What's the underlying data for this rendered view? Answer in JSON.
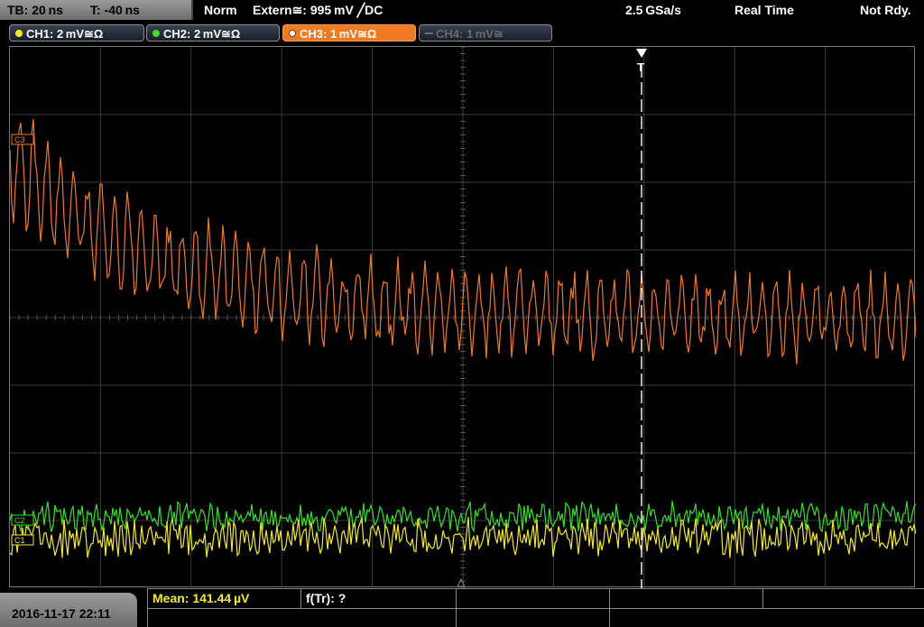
{
  "topbar": {
    "timebase": "TB: 20 ns",
    "trigger_time": "T: -40 ns",
    "mode": "Norm",
    "trigger_source": "Extern≅: 995 mV ╱DC",
    "sample_rate": "2.5 GSa/s",
    "acq_mode": "Real Time",
    "status": "Not Rdy."
  },
  "channels": [
    {
      "label": "CH1: 2 mV≅Ω",
      "color": "#f2ea23",
      "state": "on"
    },
    {
      "label": "CH2: 2 mV≅Ω",
      "color": "#36e02a",
      "state": "on"
    },
    {
      "label": "CH3: 1 mV≅Ω",
      "color": "#f07a22",
      "state": "active"
    },
    {
      "label": "CH4: 1 mV≅",
      "color": "#6a6a6a",
      "state": "off"
    }
  ],
  "markers": {
    "trigger": "T",
    "ch3": "C3",
    "ch2": "C2",
    "ch1": "C1"
  },
  "footer": {
    "datetime": "2016-11-17 22:11",
    "mean": "Mean: 141.44 µV",
    "freq": "f(Tr): ?"
  },
  "colors": {
    "ch1": "#f2ea23",
    "ch2": "#36e02a",
    "ch3": "#f07a22",
    "grid": "#3a3a3a"
  }
}
